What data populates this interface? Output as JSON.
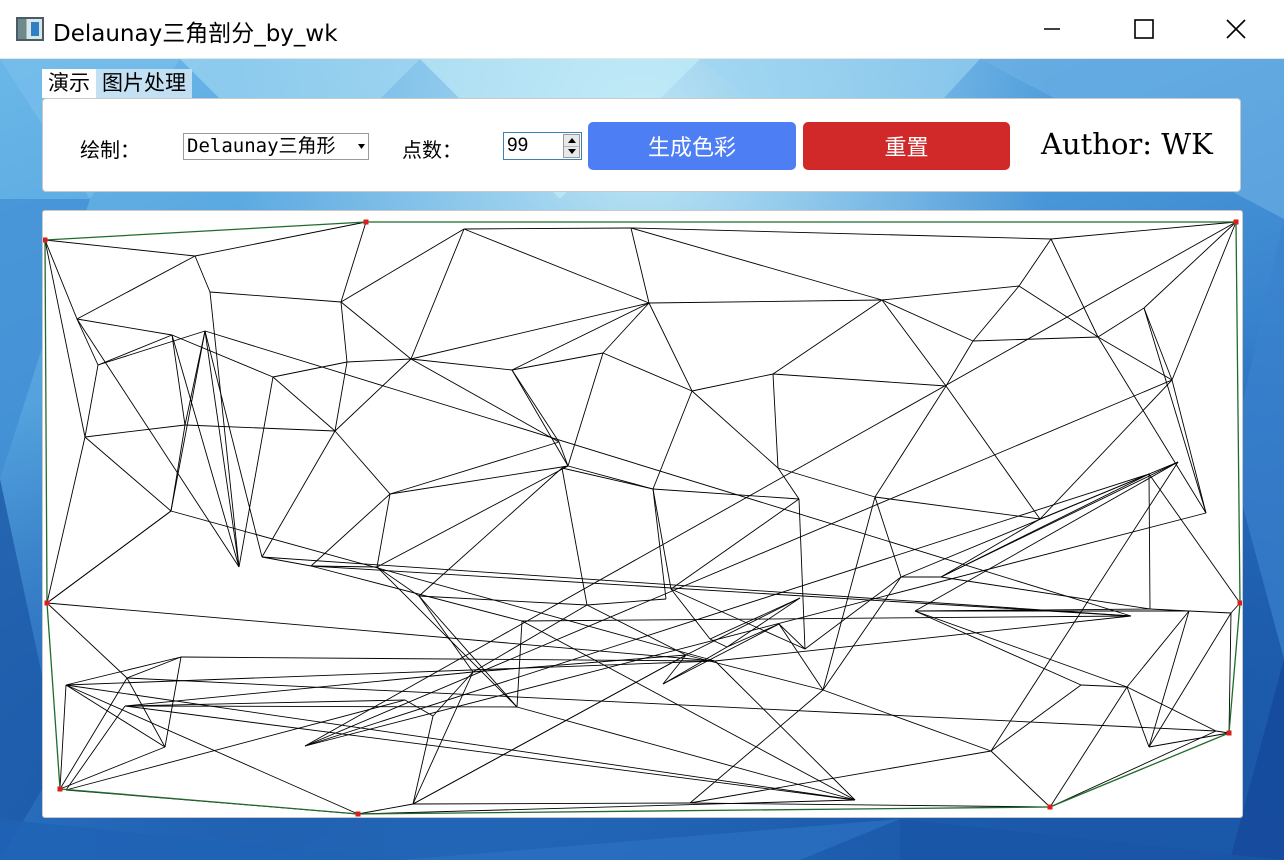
{
  "window": {
    "title": "Delaunay三角剖分_by_wk",
    "icon": "app-window-icon",
    "controls": [
      "minimize-icon",
      "maximize-icon",
      "close-icon"
    ]
  },
  "menu": {
    "items": [
      {
        "label": "演示",
        "active": true
      },
      {
        "label": "图片处理",
        "active": false
      }
    ]
  },
  "toolbar": {
    "draw_label": "绘制：",
    "draw_select_value": "Delaunay三角形",
    "points_label": "点数：",
    "points_value": "99",
    "generate_color_label": "生成色彩",
    "reset_label": "重置",
    "author": "Author: WK",
    "colors": {
      "generate_button": "#4d7ef4",
      "reset_button": "#d12929",
      "hull_edge": "#1f6b2e",
      "hull_vertex": "#d81e1e",
      "triangle_edge": "#000000"
    }
  }
}
